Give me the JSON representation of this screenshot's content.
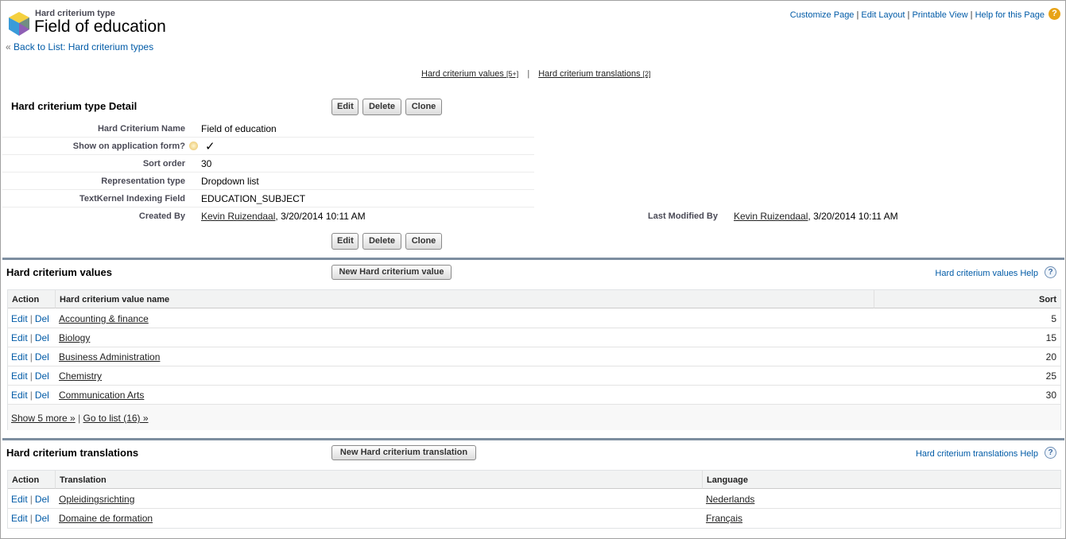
{
  "header": {
    "object_type": "Hard criterium type",
    "title": "Field of education",
    "back_link": "Back to List: Hard criterium types",
    "back_arrow": "«",
    "links": [
      "Customize Page",
      "Edit Layout",
      "Printable View",
      "Help for this Page"
    ],
    "help_icon": "?"
  },
  "related_links": [
    {
      "label": "Hard criterium values",
      "count": "[5+]"
    },
    {
      "label": "Hard criterium translations",
      "count": "[2]"
    }
  ],
  "related_links_separator": "|",
  "detail": {
    "title": "Hard criterium type Detail",
    "buttons": {
      "edit": "Edit",
      "delete": "Delete",
      "clone": "Clone"
    },
    "fields": [
      {
        "label": "Hard Criterium Name",
        "value": "Field of education"
      },
      {
        "label": "Show on application form?",
        "value": "✓"
      },
      {
        "label": "Sort order",
        "value": "30"
      },
      {
        "label": "Representation type",
        "value": "Dropdown list"
      },
      {
        "label": "TextKernel Indexing Field",
        "value": "EDUCATION_SUBJECT"
      }
    ],
    "created_by": {
      "label": "Created By",
      "user": "Kevin Ruizendaal",
      "date": ", 3/20/2014 10:11 AM"
    },
    "modified_by": {
      "label": "Last Modified By",
      "user": "Kevin Ruizendaal",
      "date": ", 3/20/2014 10:11 AM"
    }
  },
  "values_list": {
    "title": "Hard criterium values",
    "new_button": "New Hard criterium value",
    "help": "Hard criterium values Help",
    "columns": {
      "action": "Action",
      "name": "Hard criterium value name",
      "sort": "Sort"
    },
    "rows": [
      {
        "name": "Accounting & finance",
        "sort": "5"
      },
      {
        "name": "Biology",
        "sort": "15"
      },
      {
        "name": "Business Administration",
        "sort": "20"
      },
      {
        "name": "Chemistry",
        "sort": "25"
      },
      {
        "name": "Communication Arts",
        "sort": "30"
      }
    ],
    "show_more": "Show 5 more »",
    "go_to_list": "Go to list (16) »"
  },
  "translations_list": {
    "title": "Hard criterium translations",
    "new_button": "New Hard criterium translation",
    "help": "Hard criterium translations Help",
    "columns": {
      "action": "Action",
      "translation": "Translation",
      "language": "Language"
    },
    "rows": [
      {
        "translation": "Opleidingsrichting",
        "language": "Nederlands"
      },
      {
        "translation": "Domaine de formation",
        "language": "Français"
      }
    ]
  },
  "row_actions": {
    "edit": "Edit",
    "del": "Del"
  }
}
